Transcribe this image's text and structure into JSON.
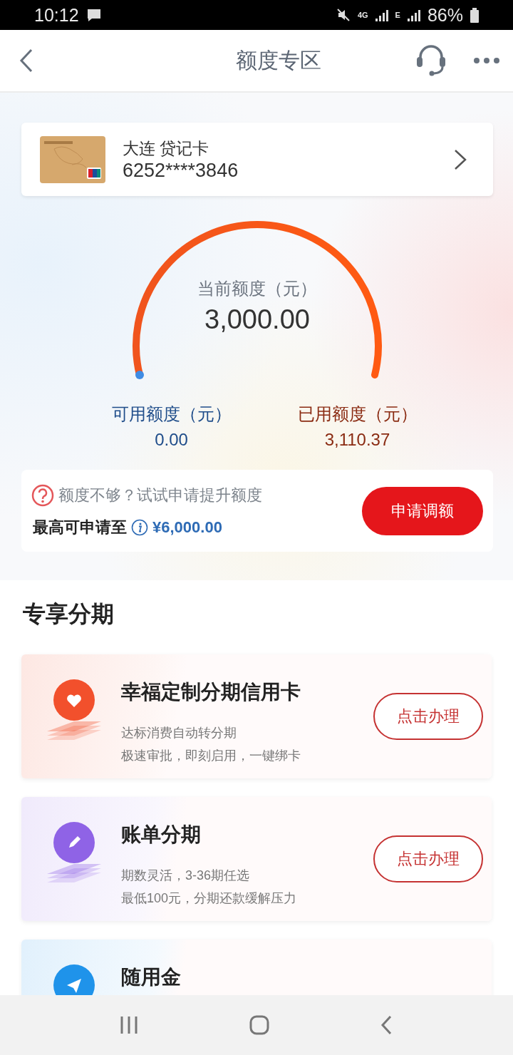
{
  "status_bar": {
    "time": "10:12",
    "network": "4G",
    "network_2": "E",
    "battery": "86%"
  },
  "header": {
    "title": "额度专区"
  },
  "account": {
    "name": "大连 贷记卡",
    "number": "6252****3846"
  },
  "limit": {
    "label": "当前额度（元）",
    "amount": "3,000.00",
    "available_label": "可用额度（元）",
    "available": "0.00",
    "used_label": "已用额度（元）",
    "used": "3,110.37"
  },
  "raise": {
    "prompt": "额度不够？试试申请提升额度",
    "max_label": "最高可申请至",
    "max_amount": "¥6,000.00",
    "button": "申请调额"
  },
  "section_title": "专享分期",
  "products": [
    {
      "title": "幸福定制分期信用卡",
      "lines": [
        "达标消费自动转分期",
        "极速审批，即刻启用，一键绑卡"
      ],
      "button": "点击办理",
      "color": "#f2502c"
    },
    {
      "title": "账单分期",
      "lines": [
        "期数灵活，3-36期任选",
        "最低100元，分期还款缓解压力"
      ],
      "button": "点击办理",
      "color": "#8f63e6"
    },
    {
      "title": "随用金",
      "color": "#1f93ea"
    }
  ]
}
